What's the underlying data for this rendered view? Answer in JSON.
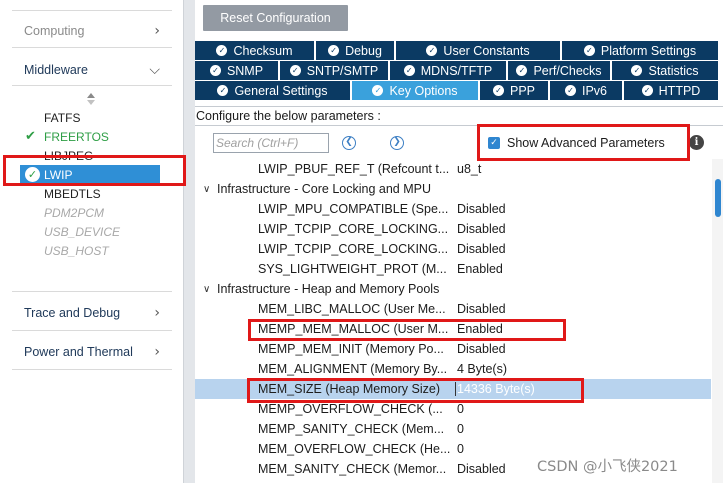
{
  "sidebar": {
    "categories": {
      "computing": "Computing",
      "middleware": "Middleware",
      "trace_and_debug": "Trace and Debug",
      "power_and_thermal": "Power and Thermal"
    },
    "middleware_items": [
      {
        "label": "FATFS",
        "state": "normal"
      },
      {
        "label": "FREERTOS",
        "state": "enabled"
      },
      {
        "label": "LIBJPEG",
        "state": "normal"
      },
      {
        "label": "LWIP",
        "state": "selected"
      },
      {
        "label": "MBEDTLS",
        "state": "normal"
      },
      {
        "label": "PDM2PCM",
        "state": "disabled"
      },
      {
        "label": "USB_DEVICE",
        "state": "disabled"
      },
      {
        "label": "USB_HOST",
        "state": "disabled"
      }
    ]
  },
  "toolbar": {
    "reset_label": "Reset Configuration"
  },
  "tabs": {
    "row1": [
      "Checksum",
      "Debug",
      "User Constants",
      "Platform Settings"
    ],
    "row2": [
      "SNMP",
      "SNTP/SMTP",
      "MDNS/TFTP",
      "Perf/Checks",
      "Statistics"
    ],
    "row3": [
      "General Settings",
      "Key Options",
      "PPP",
      "IPv6",
      "HTTPD"
    ],
    "active": "Key Options"
  },
  "config": {
    "header": "Configure the below parameters :",
    "search_placeholder": "Search (Ctrl+F)",
    "show_advanced_label": "Show Advanced Parameters",
    "show_advanced_checked": true
  },
  "params": [
    {
      "type": "param",
      "name": "LWIP_PBUF_REF_T (Refcount type in pbuf)",
      "value": "u8_t"
    },
    {
      "type": "group",
      "name": "Infrastructure - Core Locking and MPU"
    },
    {
      "type": "param",
      "name": "LWIP_MPU_COMPATIBLE (Special memory management)",
      "value": "Disabled"
    },
    {
      "type": "param",
      "name": "LWIP_TCPIP_CORE_LOCKING (Core locking)",
      "value": "Disabled"
    },
    {
      "type": "param",
      "name": "LWIP_TCPIP_CORE_LOCKING_INPUT",
      "value": "Disabled"
    },
    {
      "type": "param",
      "name": "SYS_LIGHTWEIGHT_PROT (Mutex protection)",
      "value": "Enabled"
    },
    {
      "type": "group",
      "name": "Infrastructure - Heap and Memory Pools"
    },
    {
      "type": "param",
      "name": "MEM_LIBC_MALLOC (User Memory Library)",
      "value": "Disabled"
    },
    {
      "type": "param",
      "name": "MEMP_MEM_MALLOC (User Memory Pools)",
      "value": "Enabled"
    },
    {
      "type": "param",
      "name": "MEMP_MEM_INIT (Memory Pools Init)",
      "value": "Disabled"
    },
    {
      "type": "param",
      "name": "MEM_ALIGNMENT (Memory Byte Alignment)",
      "value": "4 Byte(s)"
    },
    {
      "type": "param",
      "name": "MEM_SIZE (Heap Memory Size)",
      "value": "14336 Byte(s)",
      "selected": true
    },
    {
      "type": "param",
      "name": "MEMP_OVERFLOW_CHECK (Overflow Check)",
      "value": "0"
    },
    {
      "type": "param",
      "name": "MEMP_SANITY_CHECK (Memory Pool Sanity)",
      "value": "0"
    },
    {
      "type": "param",
      "name": "MEM_OVERFLOW_CHECK (Heap Overflow Check)",
      "value": "0"
    },
    {
      "type": "param",
      "name": "MEM_SANITY_CHECK (Memory Sanity Check)",
      "value": "Disabled"
    }
  ],
  "watermark": "CSDN @小飞侠2021",
  "colors": {
    "tab_bg": "#0b3a63",
    "tab_active": "#3aa1dc",
    "selection": "#2f8fd6",
    "highlight_box": "#e01818",
    "enabled_green": "#2e9e45"
  }
}
